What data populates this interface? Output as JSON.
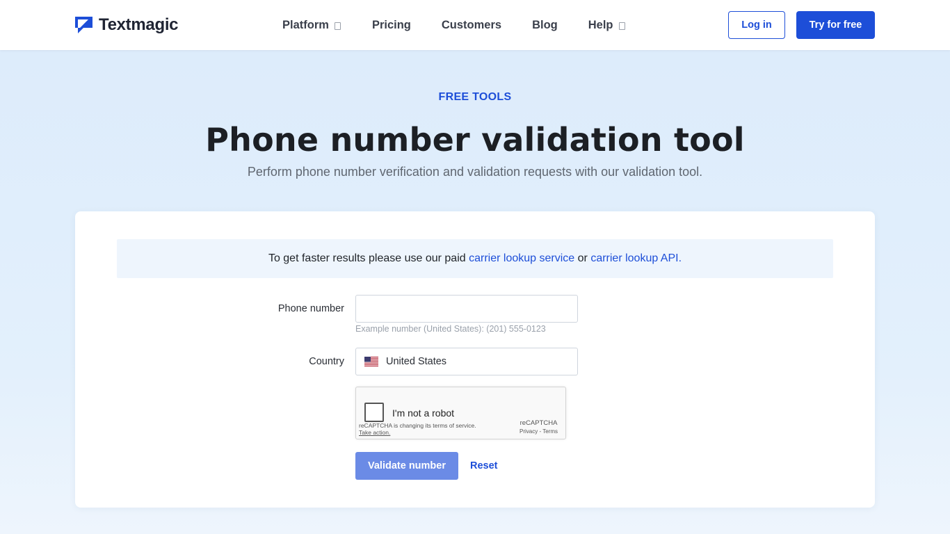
{
  "header": {
    "logo_text": "Textmagic",
    "nav": [
      {
        "label": "Platform",
        "has_dropdown": true
      },
      {
        "label": "Pricing",
        "has_dropdown": false
      },
      {
        "label": "Customers",
        "has_dropdown": false
      },
      {
        "label": "Blog",
        "has_dropdown": false
      },
      {
        "label": "Help",
        "has_dropdown": true
      }
    ],
    "login_label": "Log in",
    "try_label": "Try for free"
  },
  "hero": {
    "eyebrow": "FREE TOOLS",
    "title": "Phone number validation tool",
    "subtitle": "Perform phone number verification and validation requests with our validation tool."
  },
  "notice": {
    "text_before": "To get faster results please use our paid",
    "link1": "carrier lookup service",
    "text_middle": "or",
    "link2": "carrier lookup API."
  },
  "form": {
    "phone_label": "Phone number",
    "phone_value": "",
    "phone_hint": "Example number (United States): (201) 555-0123",
    "country_label": "Country",
    "country_value": "United States",
    "country_flag_icon": "us-flag-icon",
    "validate_label": "Validate number",
    "reset_label": "Reset"
  },
  "captcha": {
    "label": "I'm not a robot",
    "notice": "reCAPTCHA is changing its terms of service.",
    "action": "Take action.",
    "brand": "reCAPTCHA",
    "links": "Privacy - Terms"
  },
  "colors": {
    "brand_blue": "#1d4ed8",
    "validate_button": "#6b8be6",
    "page_background": "#dcebfb"
  }
}
